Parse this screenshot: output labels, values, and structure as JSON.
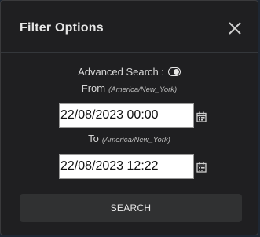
{
  "dialog": {
    "title": "Filter Options",
    "close_icon": "close-icon"
  },
  "advanced_search": {
    "label": "Advanced Search :",
    "enabled": true,
    "toggle_icon": "toggle-on-icon"
  },
  "from": {
    "label": "From",
    "timezone": "(America/New_York)",
    "value": "22/08/2023 00:00",
    "calendar_icon": "calendar-icon"
  },
  "to": {
    "label": "To",
    "timezone": "(America/New_York)",
    "value": "22/08/2023 12:22",
    "calendar_icon": "calendar-icon"
  },
  "search_button": {
    "label": "SEARCH"
  },
  "colors": {
    "dialog_bg": "#1f1f21",
    "button_bg": "#303132",
    "text": "#d6d6d6"
  }
}
